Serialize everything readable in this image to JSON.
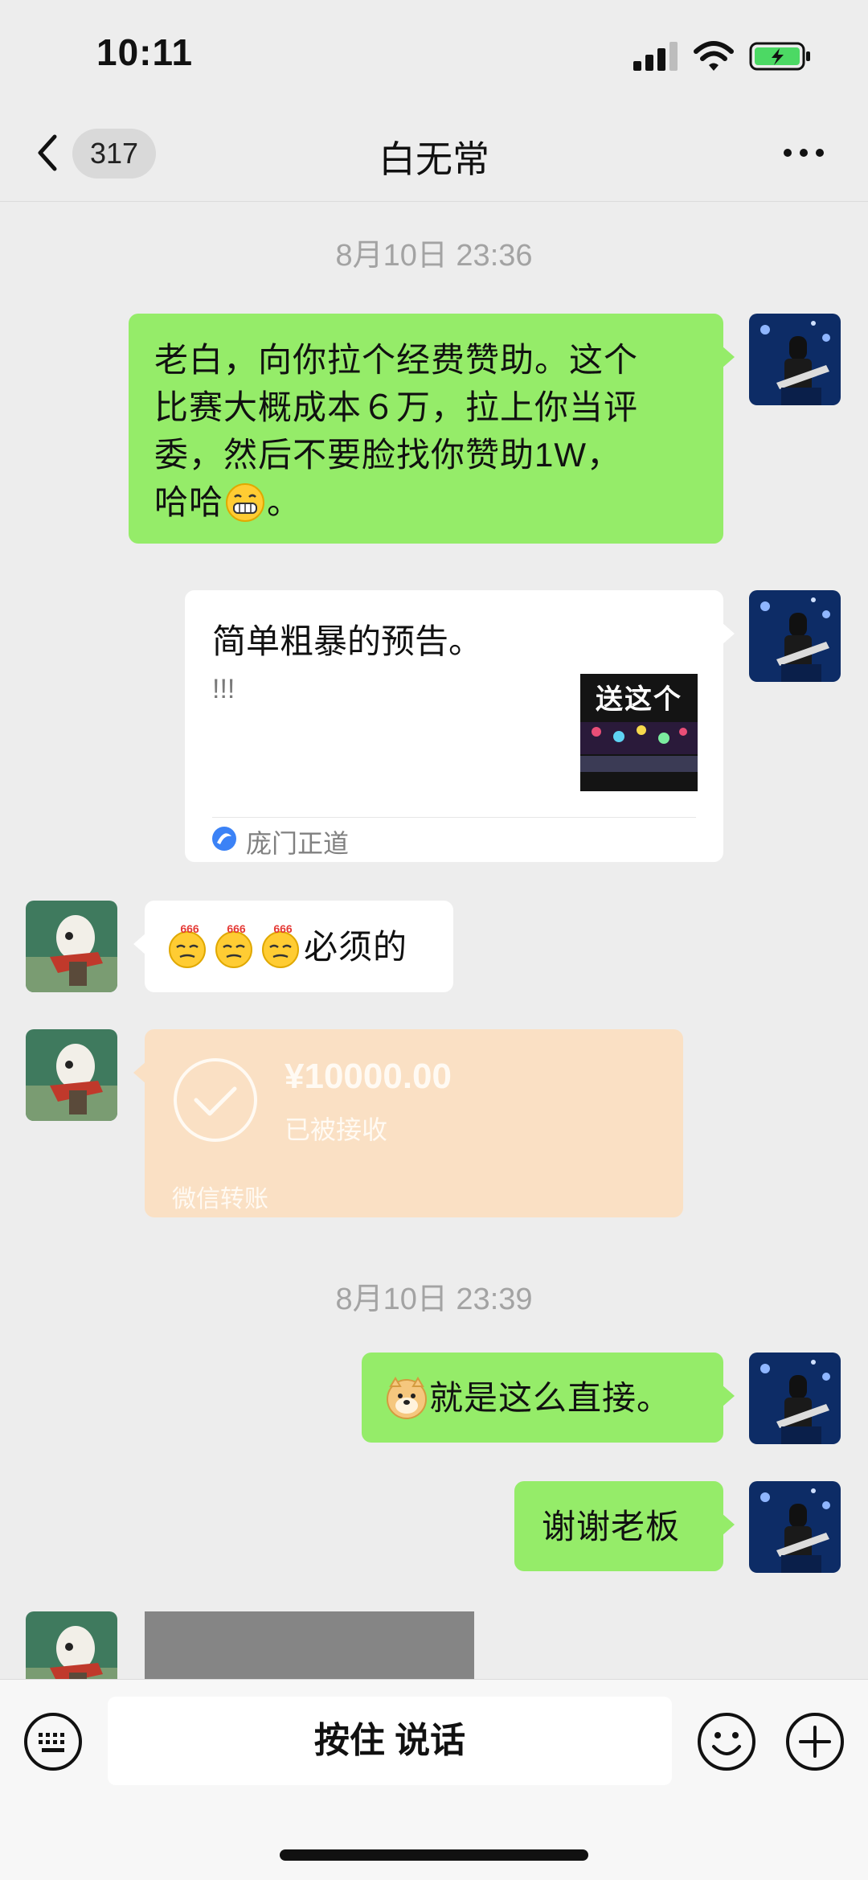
{
  "status_bar": {
    "time": "10:11",
    "battery_color": "#4cd964"
  },
  "nav": {
    "back_icon": "chevron-left-icon",
    "unread_count": "317",
    "title": "白无常",
    "more_icon": "more-dots-icon"
  },
  "messages": {
    "timestamp_1": "8月10日 23:36",
    "msg1": {
      "line1": "老白，向你拉个经费赞助。这个",
      "line2": "比赛大概成本６万，拉上你当评",
      "line3": "委，然后不要脸找你赞助1W，",
      "line4": "哈哈",
      "line4_end": "。"
    },
    "card": {
      "title": "简单粗暴的预告。",
      "desc": "!!!",
      "thumb_text": "送这个",
      "source": "庞门正道"
    },
    "msg3": {
      "text": "必须的",
      "emoji_badge": "666"
    },
    "transfer": {
      "amount": "¥10000.00",
      "status": "已被接收",
      "label": "微信转账"
    },
    "timestamp_2": "8月10日 23:39",
    "msg5": {
      "text": "就是这么直接。"
    },
    "msg6": {
      "text": "谢谢老板"
    }
  },
  "input_bar": {
    "hold_to_talk": "按住 说话",
    "keyboard_icon": "keyboard-icon",
    "emoji_icon": "emoji-icon",
    "plus_icon": "plus-icon"
  },
  "colors": {
    "background": "#ededed",
    "sent_bubble": "#95ec69",
    "received_bubble": "#ffffff",
    "transfer_bubble": "#fae0c4"
  }
}
